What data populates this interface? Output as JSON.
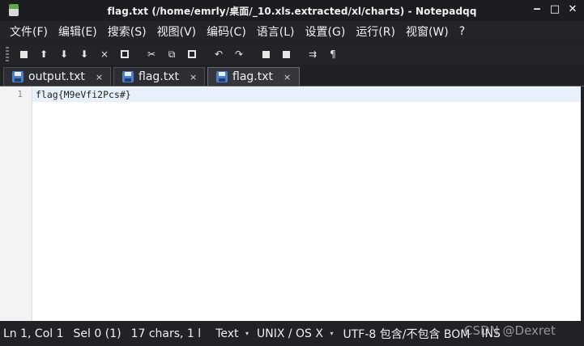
{
  "window": {
    "title": "flag.txt (/home/emrly/桌面/_10.xls.extracted/xl/charts) - Notepadqq",
    "minimize_glyph": "‒",
    "maximize_glyph": "□",
    "close_glyph": "✕"
  },
  "menu": {
    "items": [
      {
        "label": "文件(F)"
      },
      {
        "label": "编辑(E)"
      },
      {
        "label": "搜索(S)"
      },
      {
        "label": "视图(V)"
      },
      {
        "label": "编码(C)"
      },
      {
        "label": "语言(L)"
      },
      {
        "label": "设置(G)"
      },
      {
        "label": "运行(R)"
      },
      {
        "label": "视窗(W)"
      },
      {
        "label": "?"
      }
    ]
  },
  "toolbar": {
    "icons": [
      "new-file-icon",
      "open-file-icon",
      "save-icon",
      "save-all-icon",
      "close-file-icon",
      "close-all-icon",
      "cut-icon",
      "copy-icon",
      "paste-icon",
      "undo-icon",
      "redo-icon",
      "zoom-in-icon",
      "zoom-out-icon",
      "word-wrap-icon",
      "show-all-chars-icon"
    ],
    "glyphs": {
      "close": "×",
      "cut": "✂",
      "copy": "⧉",
      "paste": "📋",
      "undo": "↶",
      "redo": "↷",
      "wrap": "⇉",
      "pilcrow": "¶",
      "up": "⬆",
      "down": "⬇"
    }
  },
  "tabs": [
    {
      "label": "output.txt",
      "close": "×",
      "active": false
    },
    {
      "label": "flag.txt",
      "close": "×",
      "active": false
    },
    {
      "label": "flag.txt",
      "close": "×",
      "active": true
    }
  ],
  "editor": {
    "lines": [
      {
        "number": "1",
        "text": "flag{M9eVfi2Pcs#}"
      }
    ]
  },
  "status": {
    "position": "Ln 1, Col 1",
    "selection": "Sel 0 (1)",
    "chars": "17 chars, 1 l",
    "language": "Text",
    "eol": "UNIX / OS X",
    "encoding": "UTF-8 包含/不包含 BOM",
    "mode": "INS",
    "dropdown_glyph": "▾"
  },
  "watermark": "CSDN @Dexret",
  "colors": {
    "chrome_bg": "#222428",
    "editor_bg": "#ffffff",
    "current_line": "#e8f0fb",
    "tab_icon": "#4d7fc9"
  }
}
